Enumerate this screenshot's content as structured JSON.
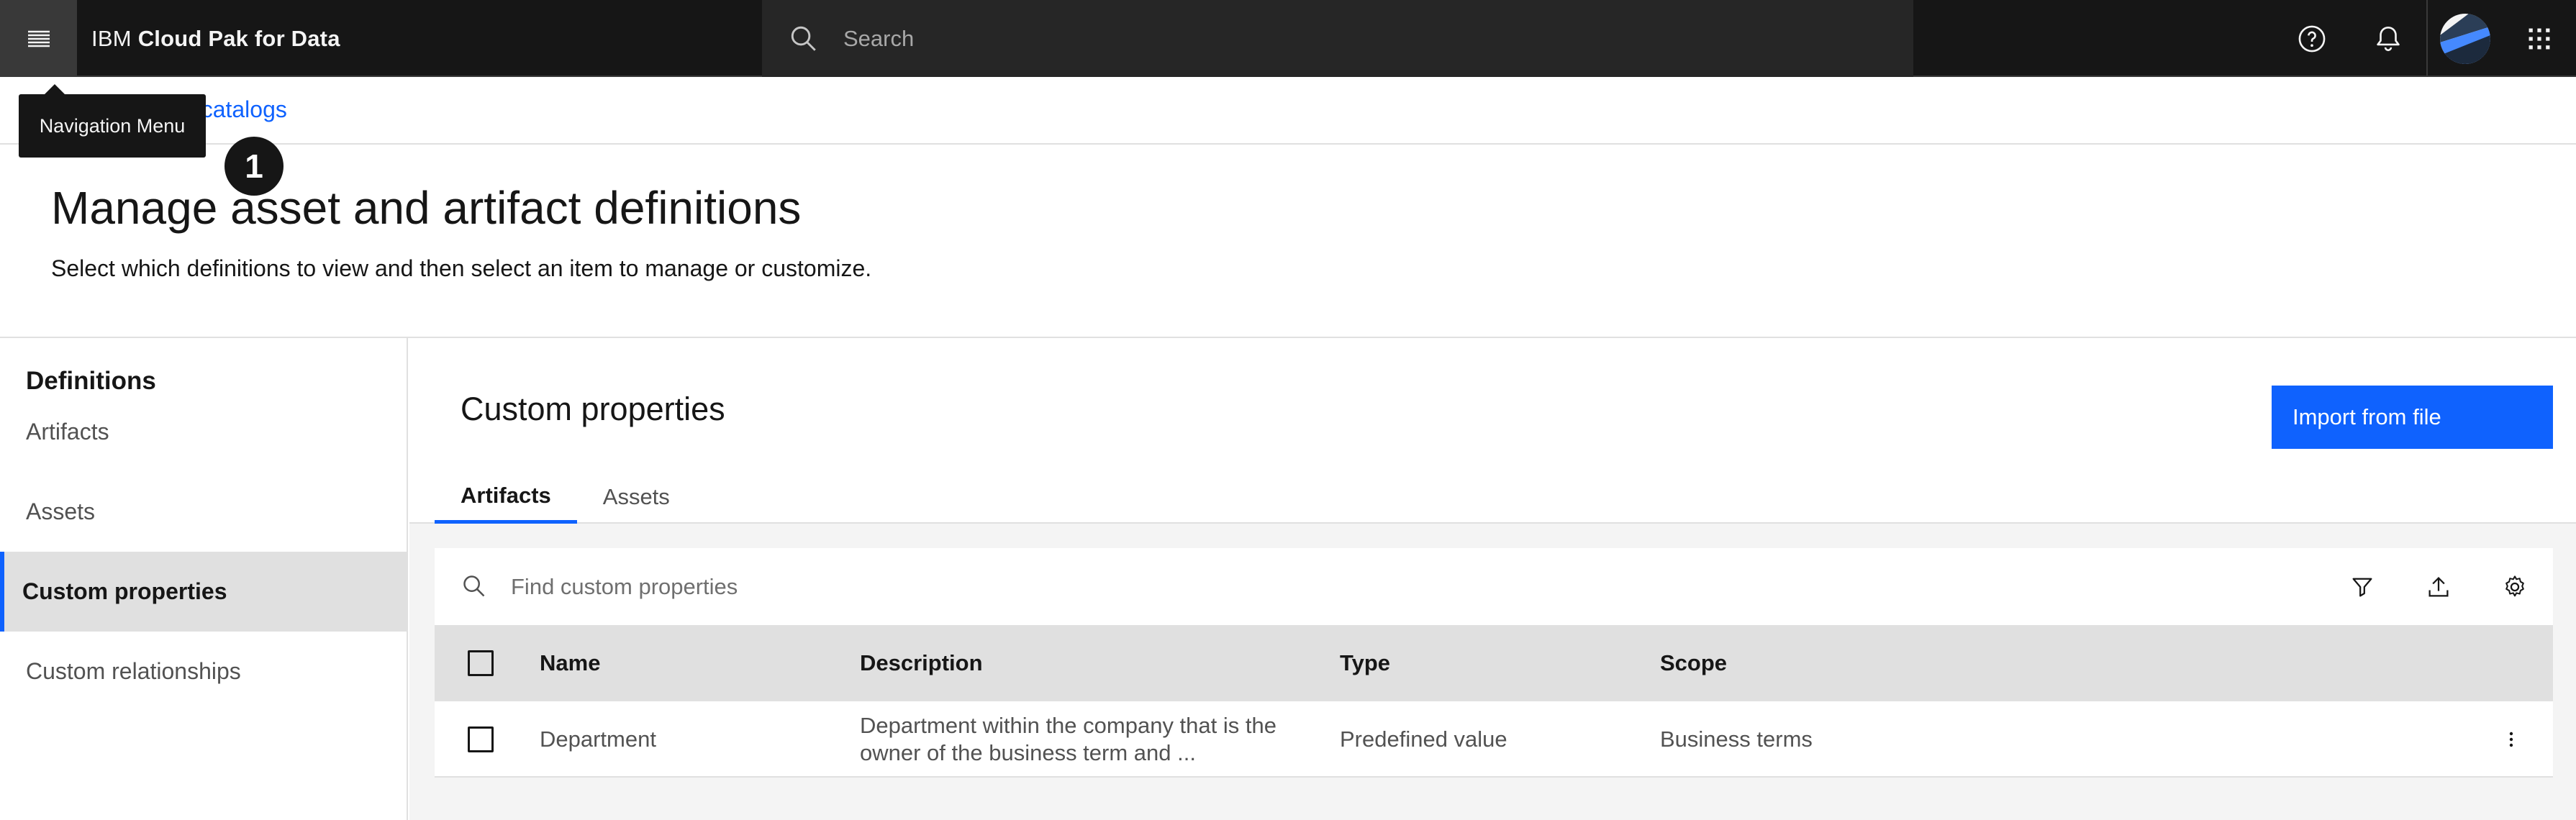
{
  "header": {
    "brand_prefix": "IBM",
    "brand_name": "Cloud Pak for Data",
    "search_placeholder": "Search",
    "icons": [
      "menu-icon",
      "search-icon",
      "help-icon",
      "notification-icon",
      "avatar",
      "app-switcher-icon"
    ]
  },
  "tooltip": {
    "text": "Navigation Menu",
    "step_number": "1"
  },
  "breadcrumb": {
    "link_text": "d catalogs"
  },
  "page": {
    "title": "Manage asset and artifact definitions",
    "subtitle": "Select which definitions to view and then select an item to manage or customize."
  },
  "sidebar": {
    "title": "Definitions",
    "items": [
      {
        "label": "Artifacts",
        "active": false
      },
      {
        "label": "Assets",
        "active": false
      },
      {
        "label": "Custom properties",
        "active": true
      },
      {
        "label": "Custom relationships",
        "active": false
      }
    ]
  },
  "main": {
    "section_title": "Custom properties",
    "import_button": "Import from file",
    "tabs": [
      {
        "label": "Artifacts",
        "active": true
      },
      {
        "label": "Assets",
        "active": false
      }
    ],
    "find_placeholder": "Find custom properties",
    "toolbar_icons": [
      "filter-icon",
      "upload-icon",
      "settings-icon"
    ]
  },
  "table": {
    "columns": [
      "Name",
      "Description",
      "Type",
      "Scope"
    ],
    "rows": [
      {
        "name": "Department",
        "description": "Department within the company that is the owner of the business term and ...",
        "type": "Predefined value",
        "scope": "Business terms"
      }
    ]
  },
  "colors": {
    "header_bg": "#161616",
    "accent": "#0f62fe",
    "nav_active_bg": "#e0e0e0",
    "table_header_bg": "#e0e0e0"
  }
}
